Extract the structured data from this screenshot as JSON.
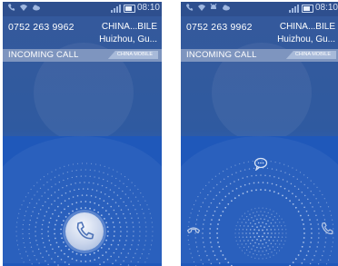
{
  "status_bar": {
    "time": "08:10",
    "phone_1_icons": [
      "phone-icon",
      "wifi-icon",
      "cloud-icon"
    ],
    "phone_2_icons": [
      "phone-icon",
      "wifi-icon",
      "android-icon",
      "cloud-icon"
    ]
  },
  "call": {
    "number": "0752 263 9962",
    "carrier": "CHINA...BILE",
    "location": "Huizhou, Gu...",
    "label": "INCOMING CALL",
    "sim_tag": "CHINA MOBILE"
  },
  "screen_1": {
    "answer_button_icon": "phone-handset-icon"
  },
  "screen_2": {
    "actions": [
      "message-icon",
      "decline-icon",
      "answer-icon"
    ]
  },
  "colors": {
    "background": "#2f5aa0",
    "lower": "#1f58ba",
    "bar": "#7e95bf"
  }
}
